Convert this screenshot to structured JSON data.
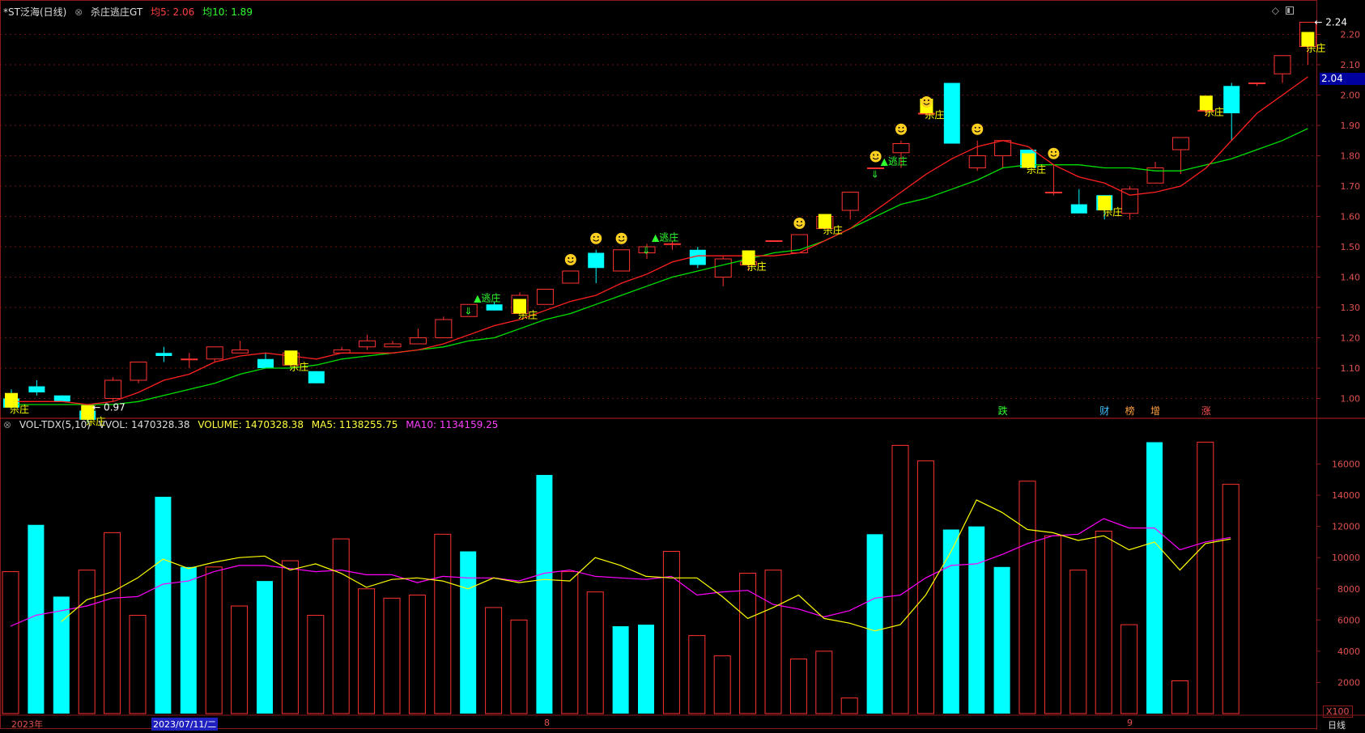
{
  "header_price": {
    "stock": "*ST泛海(日线)",
    "indicator": "杀庄逃庄GT",
    "ma5_label": "均5: 2.06",
    "ma10_label": "均10: 1.89"
  },
  "header_vol": {
    "name": "VOL-TDX(5,10)",
    "vvol": "VVOL: 1470328.38",
    "volume": "VOLUME: 1470328.38",
    "ma5": "MA5: 1138255.75",
    "ma10": "MA10: 1134159.25"
  },
  "colors": {
    "up": "#ff3232",
    "down": "#00ffff",
    "ma5": "#ff2020",
    "ma10": "#00e000",
    "vma5": "#ffff00",
    "vma10": "#ff00ff",
    "grid": "#8a1a1a",
    "sell": "#ffff00",
    "buy": "#30ff30"
  },
  "current_price": "2.04",
  "high_mark": "2.24",
  "low_mark": "0.97",
  "bottom_labels": {
    "year": "2023年",
    "date": "2023/07/11/二",
    "m8": "8",
    "m9": "9",
    "period": "日线",
    "scale": "X100"
  },
  "top_icons": {
    "diamond": "◇"
  },
  "event_labels": [
    {
      "i": 39,
      "text": "跌",
      "color": "#30ff30"
    },
    {
      "i": 43,
      "text": "财",
      "color": "#40c0ff"
    },
    {
      "i": 44,
      "text": "榜",
      "color": "#ffa040"
    },
    {
      "i": 45,
      "text": "增",
      "color": "#ffa040"
    },
    {
      "i": 47,
      "text": "涨",
      "color": "#ff5050"
    }
  ],
  "chart_data": [
    {
      "type": "candlestick",
      "title": "*ST泛海(日线)",
      "ylim": [
        0.94,
        2.26
      ],
      "yticks": [
        1.0,
        1.1,
        1.2,
        1.3,
        1.4,
        1.5,
        1.6,
        1.7,
        1.8,
        1.9,
        2.0,
        2.1,
        2.2
      ],
      "candles": [
        {
          "o": 1.0,
          "h": 1.03,
          "l": 0.98,
          "c": 0.97
        },
        {
          "o": 1.04,
          "h": 1.06,
          "l": 1.01,
          "c": 1.02
        },
        {
          "o": 1.01,
          "h": 1.01,
          "l": 0.99,
          "c": 0.99
        },
        {
          "o": 0.96,
          "h": 0.96,
          "l": 0.92,
          "c": 0.93
        },
        {
          "o": 1.0,
          "h": 1.07,
          "l": 0.99,
          "c": 1.06
        },
        {
          "o": 1.06,
          "h": 1.12,
          "l": 1.05,
          "c": 1.12
        },
        {
          "o": 1.15,
          "h": 1.17,
          "l": 1.12,
          "c": 1.14
        },
        {
          "o": 1.13,
          "h": 1.15,
          "l": 1.1,
          "c": 1.13
        },
        {
          "o": 1.13,
          "h": 1.17,
          "l": 1.12,
          "c": 1.17
        },
        {
          "o": 1.15,
          "h": 1.19,
          "l": 1.15,
          "c": 1.16
        },
        {
          "o": 1.13,
          "h": 1.15,
          "l": 1.1,
          "c": 1.1
        },
        {
          "o": 1.11,
          "h": 1.15,
          "l": 1.11,
          "c": 1.15
        },
        {
          "o": 1.09,
          "h": 1.09,
          "l": 1.05,
          "c": 1.05
        },
        {
          "o": 1.15,
          "h": 1.17,
          "l": 1.15,
          "c": 1.16
        },
        {
          "o": 1.17,
          "h": 1.21,
          "l": 1.16,
          "c": 1.19
        },
        {
          "o": 1.17,
          "h": 1.19,
          "l": 1.17,
          "c": 1.18
        },
        {
          "o": 1.18,
          "h": 1.23,
          "l": 1.18,
          "c": 1.2
        },
        {
          "o": 1.2,
          "h": 1.27,
          "l": 1.2,
          "c": 1.26
        },
        {
          "o": 1.27,
          "h": 1.31,
          "l": 1.27,
          "c": 1.31
        },
        {
          "o": 1.31,
          "h": 1.32,
          "l": 1.29,
          "c": 1.29
        },
        {
          "o": 1.28,
          "h": 1.35,
          "l": 1.28,
          "c": 1.34
        },
        {
          "o": 1.31,
          "h": 1.36,
          "l": 1.31,
          "c": 1.36
        },
        {
          "o": 1.38,
          "h": 1.42,
          "l": 1.38,
          "c": 1.42
        },
        {
          "o": 1.48,
          "h": 1.49,
          "l": 1.38,
          "c": 1.43
        },
        {
          "o": 1.42,
          "h": 1.49,
          "l": 1.42,
          "c": 1.49
        },
        {
          "o": 1.48,
          "h": 1.51,
          "l": 1.46,
          "c": 1.5
        },
        {
          "o": 1.51,
          "h": 1.52,
          "l": 1.49,
          "c": 1.51
        },
        {
          "o": 1.49,
          "h": 1.5,
          "l": 1.43,
          "c": 1.44
        },
        {
          "o": 1.4,
          "h": 1.47,
          "l": 1.37,
          "c": 1.46
        },
        {
          "o": 1.44,
          "h": 1.46,
          "l": 1.42,
          "c": 1.45
        },
        {
          "o": 1.52,
          "h": 1.52,
          "l": 1.52,
          "c": 1.52
        },
        {
          "o": 1.48,
          "h": 1.54,
          "l": 1.48,
          "c": 1.54
        },
        {
          "o": 1.56,
          "h": 1.6,
          "l": 1.56,
          "c": 1.6
        },
        {
          "o": 1.62,
          "h": 1.68,
          "l": 1.59,
          "c": 1.68
        },
        {
          "o": 1.76,
          "h": 1.76,
          "l": 1.76,
          "c": 1.76
        },
        {
          "o": 1.81,
          "h": 1.85,
          "l": 1.76,
          "c": 1.84
        },
        {
          "o": 1.94,
          "h": 1.94,
          "l": 1.94,
          "c": 1.94
        },
        {
          "o": 2.04,
          "h": 2.04,
          "l": 1.84,
          "c": 1.84
        },
        {
          "o": 1.76,
          "h": 1.85,
          "l": 1.75,
          "c": 1.8
        },
        {
          "o": 1.8,
          "h": 1.85,
          "l": 1.76,
          "c": 1.85
        },
        {
          "o": 1.82,
          "h": 1.82,
          "l": 1.76,
          "c": 1.76
        },
        {
          "o": 1.68,
          "h": 1.77,
          "l": 1.67,
          "c": 1.68
        },
        {
          "o": 1.64,
          "h": 1.69,
          "l": 1.61,
          "c": 1.61
        },
        {
          "o": 1.67,
          "h": 1.67,
          "l": 1.59,
          "c": 1.62
        },
        {
          "o": 1.61,
          "h": 1.7,
          "l": 1.59,
          "c": 1.69
        },
        {
          "o": 1.71,
          "h": 1.78,
          "l": 1.71,
          "c": 1.76
        },
        {
          "o": 1.82,
          "h": 1.86,
          "l": 1.74,
          "c": 1.86
        },
        {
          "o": 1.95,
          "h": 1.95,
          "l": 1.93,
          "c": 1.95
        },
        {
          "o": 2.03,
          "h": 2.04,
          "l": 1.85,
          "c": 1.94
        },
        {
          "o": 2.04,
          "h": 2.04,
          "l": 2.03,
          "c": 2.04
        },
        {
          "o": 2.07,
          "h": 2.13,
          "l": 2.04,
          "c": 2.13
        },
        {
          "o": 2.16,
          "h": 2.24,
          "l": 2.1,
          "c": 2.24
        }
      ],
      "ma5": [
        0.99,
        0.99,
        0.99,
        0.98,
        0.99,
        1.02,
        1.06,
        1.08,
        1.12,
        1.14,
        1.15,
        1.14,
        1.13,
        1.15,
        1.15,
        1.15,
        1.16,
        1.18,
        1.21,
        1.24,
        1.26,
        1.29,
        1.32,
        1.34,
        1.38,
        1.41,
        1.45,
        1.47,
        1.47,
        1.47,
        1.47,
        1.48,
        1.52,
        1.56,
        1.62,
        1.68,
        1.74,
        1.79,
        1.83,
        1.85,
        1.83,
        1.77,
        1.73,
        1.71,
        1.67,
        1.68,
        1.7,
        1.76,
        1.85,
        1.94,
        2.0,
        2.06
      ],
      "ma10": [
        0.98,
        0.98,
        0.98,
        0.98,
        0.98,
        0.99,
        1.01,
        1.03,
        1.05,
        1.08,
        1.1,
        1.1,
        1.11,
        1.13,
        1.14,
        1.15,
        1.16,
        1.17,
        1.19,
        1.2,
        1.23,
        1.26,
        1.28,
        1.31,
        1.34,
        1.37,
        1.4,
        1.42,
        1.44,
        1.46,
        1.48,
        1.49,
        1.52,
        1.56,
        1.6,
        1.64,
        1.66,
        1.69,
        1.72,
        1.76,
        1.77,
        1.77,
        1.77,
        1.76,
        1.76,
        1.75,
        1.75,
        1.77,
        1.79,
        1.82,
        1.85,
        1.89
      ],
      "sell_marks": [
        {
          "i": 0,
          "text": "杀庄"
        },
        {
          "i": 3,
          "text": "杀庄"
        },
        {
          "i": 11,
          "text": "杀庄"
        },
        {
          "i": 20,
          "text": "杀庄"
        },
        {
          "i": 29,
          "text": "杀庄"
        },
        {
          "i": 32,
          "text": "杀庄"
        },
        {
          "i": 36,
          "text": "杀庄"
        },
        {
          "i": 40,
          "text": "杀庄"
        },
        {
          "i": 43,
          "text": "杀庄"
        },
        {
          "i": 47,
          "text": "杀庄"
        },
        {
          "i": 51,
          "text": "杀庄"
        }
      ],
      "buy_marks": [
        {
          "i": 18,
          "text": "▲逃庄"
        },
        {
          "i": 25,
          "text": "▲逃庄"
        },
        {
          "i": 34,
          "text": "▲逃庄"
        }
      ],
      "smiley_marks": [
        22,
        23,
        24,
        31,
        34,
        35,
        36,
        38,
        41
      ]
    },
    {
      "type": "bar",
      "title": "VOL-TDX(5,10)",
      "ylim": [
        0,
        18000
      ],
      "yticks": [
        2000,
        4000,
        6000,
        8000,
        10000,
        12000,
        14000,
        16000
      ],
      "values": [
        9100,
        12100,
        7500,
        9200,
        11600,
        6300,
        13900,
        9400,
        9400,
        6900,
        8500,
        9800,
        6300,
        11200,
        8000,
        7400,
        7600,
        11500,
        10400,
        6800,
        6000,
        15300,
        9100,
        7800,
        5600,
        5700,
        10400,
        5000,
        3700,
        9000,
        9200,
        3500,
        4000,
        1000,
        11500,
        17200,
        16200,
        11800,
        12000,
        9400,
        14900,
        11400,
        9200,
        11700,
        5700,
        17400,
        2100,
        17400,
        14700
      ],
      "vma5": [
        5900,
        7300,
        7800,
        8700,
        9900,
        9300,
        9700,
        10000,
        10100,
        9200,
        9600,
        9000,
        8100,
        8600,
        8700,
        8500,
        8000,
        8700,
        8400,
        8600,
        8500,
        10000,
        9500,
        8800,
        8700,
        8700,
        7500,
        6100,
        6800,
        7600,
        6100,
        5800,
        5300,
        5700,
        7600,
        10400,
        13700,
        12900,
        11800,
        11600,
        11100,
        11400,
        10500,
        11000,
        9200,
        10900,
        11200
      ],
      "vma10": [
        5600,
        6300,
        6600,
        6900,
        7400,
        7500,
        8300,
        8500,
        9100,
        9500,
        9500,
        9300,
        9100,
        9200,
        8900,
        8900,
        8400,
        8800,
        8700,
        8700,
        8500,
        9000,
        9200,
        8800,
        8700,
        8600,
        8800,
        7600,
        7800,
        7900,
        7000,
        6700,
        6200,
        6600,
        7400,
        7600,
        8700,
        9500,
        9600,
        10200,
        10900,
        11400,
        11500,
        12500,
        11900,
        11900,
        10500,
        11000,
        11300
      ]
    }
  ]
}
